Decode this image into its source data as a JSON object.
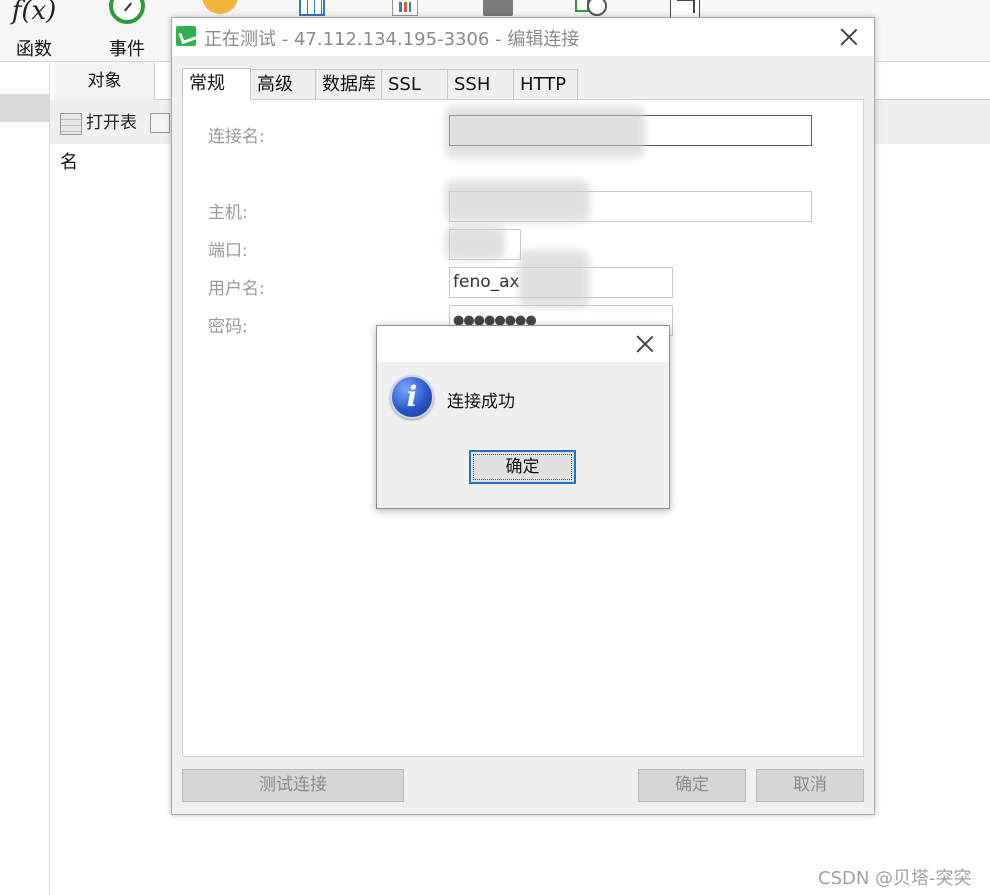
{
  "toolbar": {
    "items": [
      {
        "label": "函数",
        "icon": "function-icon",
        "glyph": "f(x)"
      },
      {
        "label": "事件",
        "icon": "event-clock-icon"
      },
      {
        "label": "",
        "icon": "user-icon"
      },
      {
        "label": "",
        "icon": "table-grid-icon"
      },
      {
        "label": "",
        "icon": "report-icon"
      },
      {
        "label": "",
        "icon": "sync-icon"
      },
      {
        "label": "",
        "icon": "schedule-icon"
      },
      {
        "label": "",
        "icon": "model-icon"
      }
    ]
  },
  "object_pane": {
    "tab_label": "对象",
    "open_table_label": "打开表",
    "column_header": "名"
  },
  "dialog": {
    "title": "正在测试 - 47.112.134.195-3306 - 编辑连接",
    "tabs": [
      "常规",
      "高级",
      "数据库",
      "SSL",
      "SSH",
      "HTTP"
    ],
    "active_tab": "常规",
    "fields": {
      "connection_name_label": "连接名:",
      "host_label": "主机:",
      "port_label": "端口:",
      "username_label": "用户名:",
      "username_value": "feno_ax",
      "password_label": "密码:",
      "password_value": "●●●●●●●●"
    },
    "buttons": {
      "test": "测试连接",
      "ok": "确定",
      "cancel": "取消"
    }
  },
  "message_box": {
    "icon": "information-icon",
    "icon_glyph": "i",
    "text": "连接成功",
    "ok": "确定"
  },
  "watermark": "CSDN @贝塔-突突",
  "colors": {
    "accent_blue": "#1f73c9",
    "app_green": "#2fb24b",
    "disabled_text": "#8c8c8c"
  }
}
